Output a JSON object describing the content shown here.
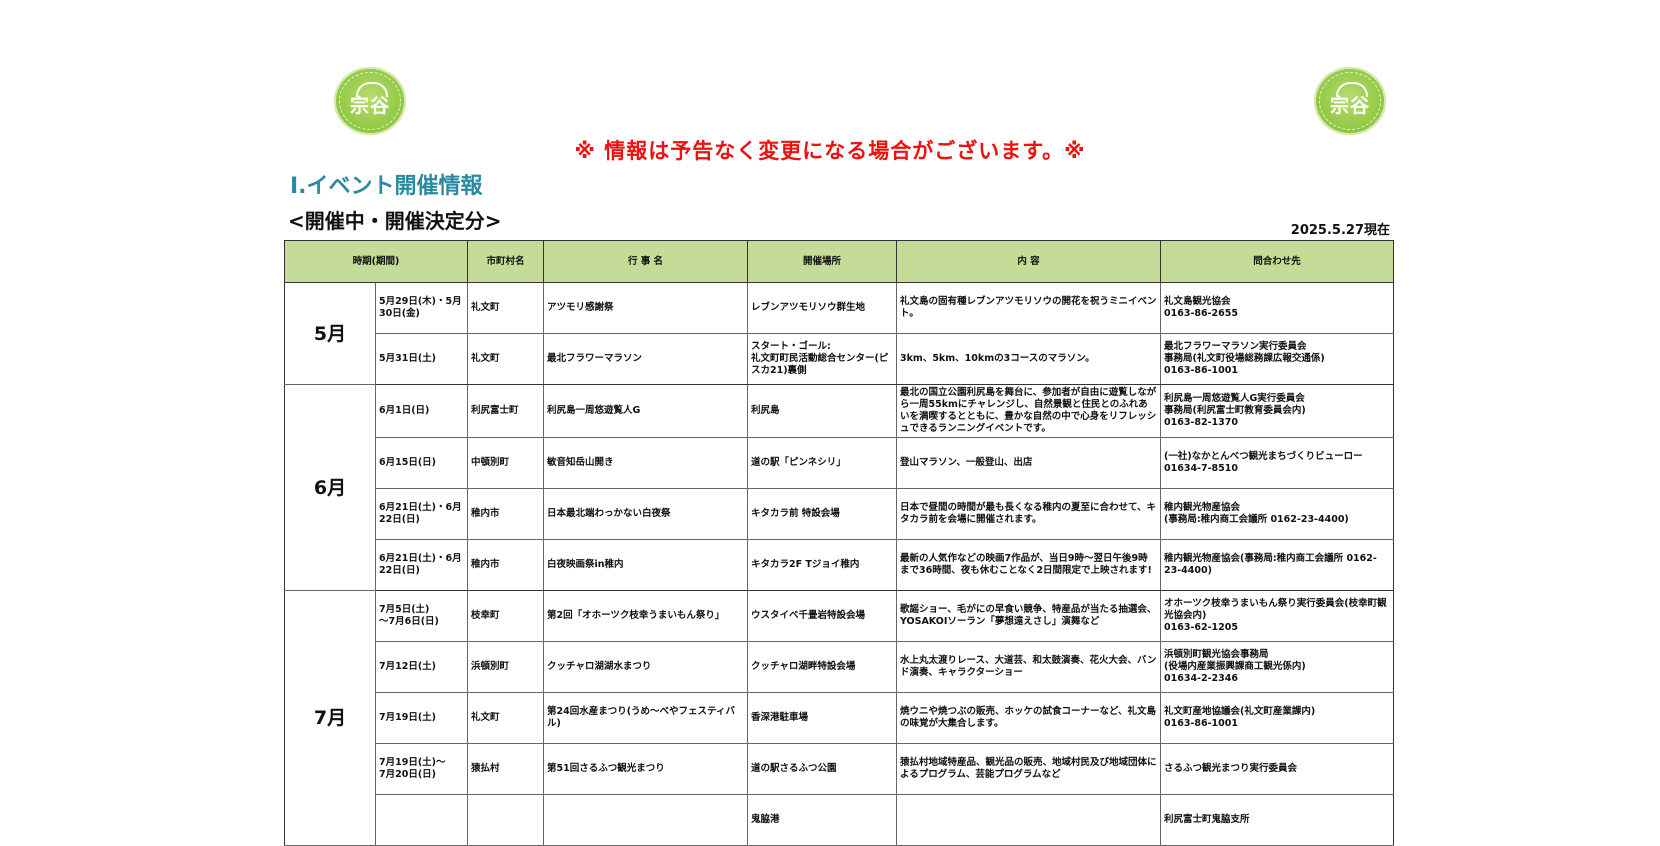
{
  "logo": {
    "text": "宗谷"
  },
  "notice": "※ 情報は予告なく変更になる場合がございます。※",
  "section_title": "Ⅰ.イベント開催情報",
  "sub_title": "<開催中・開催決定分>",
  "as_of": "2025.5.27現在",
  "colors": {
    "header_bg": "#c4dc98",
    "notice": "#ee1111",
    "section_title": "#2b8aa1",
    "logo": "#8cc63f"
  },
  "table": {
    "headers": [
      "時期(期間)",
      "市町村名",
      "行 事 名",
      "開催場所",
      "内 容",
      "問合わせ先"
    ],
    "groups": [
      {
        "month": "5月",
        "rows": [
          {
            "date": "5月29日(木)・5月30日(金)",
            "town": "礼文町",
            "event": "アツモリ感謝祭",
            "place": "レブンアツモリソウ群生地",
            "content": "礼文島の固有種レブンアツモリソウの開花を祝うミニイベント。",
            "contact": "礼文島観光協会\n0163-86-2655"
          },
          {
            "date": "5月31日(土)",
            "town": "礼文町",
            "event": "最北フラワーマラソン",
            "place": "スタート・ゴール:\n礼文町町民活動総合センター(ピスカ21)裏側",
            "content": "3km、5km、10kmの3コースのマラソン。",
            "contact": "最北フラワーマラソン実行委員会\n事務局(礼文町役場総務課広報交通係)\n0163-86-1001"
          }
        ]
      },
      {
        "month": "6月",
        "rows": [
          {
            "date": "6月1日(日)",
            "town": "利尻富士町",
            "event": "利尻島一周悠遊覧人G",
            "place": "利尻島",
            "content": "最北の国立公園利尻島を舞台に、参加者が自由に遊覧しながら一周55kmにチャレンジし、自然景観と住民とのふれあいを満喫するとともに、豊かな自然の中で心身をリフレッシュできるランニングイベントです。",
            "contact": "利尻島一周悠遊覧人G実行委員会\n事務局(利尻富士町教育委員会内)\n0163-82-1370"
          },
          {
            "date": "6月15日(日)",
            "town": "中頓別町",
            "event": "敏音知岳山開き",
            "place": "道の駅「ピンネシリ」",
            "content": "登山マラソン、一般登山、出店",
            "contact": "(一社)なかとんべつ観光まちづくりビューロー\n01634-7-8510"
          },
          {
            "date": "6月21日(土)・6月22日(日)",
            "town": "稚内市",
            "event": "日本最北端わっかない白夜祭",
            "place": "キタカラ前 特設会場",
            "content": "日本で昼間の時間が最も長くなる稚内の夏至に合わせて、キタカラ前を会場に開催されます。",
            "contact": "稚内観光物産協会\n(事務局:稚内商工会議所 0162-23-4400)"
          },
          {
            "date": "6月21日(土)・6月22日(日)",
            "town": "稚内市",
            "event": "白夜映画祭in稚内",
            "place": "キタカラ2F Tジョイ稚内",
            "content": "最新の人気作などの映画7作品が、当日9時～翌日午後9時まで36時間、夜も休むことなく2日間限定で上映されます!",
            "contact": "稚内観光物産協会(事務局:稚内商工会議所 0162-23-4400)"
          }
        ]
      },
      {
        "month": "7月",
        "rows": [
          {
            "date": "7月5日(土)\n～7月6日(日)",
            "town": "枝幸町",
            "event": "第2回「オホーツク枝幸うまいもん祭り」",
            "place": "ウスタイベ千畳岩特設会場",
            "content": "歌謡ショー、毛がにの早食い競争、特産品が当たる抽選会、YOSAKOIソーラン「夢想遠えさし」演舞など",
            "contact": "オホーツク枝幸うまいもん祭り実行委員会(枝幸町観光協会内)\n0163-62-1205"
          },
          {
            "date": "7月12日(土)",
            "town": "浜頓別町",
            "event": "クッチャロ湖湖水まつり",
            "place": "クッチャロ湖畔特設会場",
            "content": "水上丸太渡りレース、大道芸、和太鼓演奏、花火大会、バンド演奏、キャラクターショー",
            "contact": "浜頓別町観光協会事務局\n(役場内産業振興課商工観光係内)\n01634-2-2346"
          },
          {
            "date": "7月19日(土)",
            "town": "礼文町",
            "event": "第24回水産まつり(うめ～べやフェスティバル)",
            "place": "香深港駐車場",
            "content": "焼ウニや焼つぶの販売、ホッケの試食コーナーなど、礼文島の味覚が大集合します。",
            "contact": "礼文町産地協議会(礼文町産業課内)\n0163-86-1001"
          },
          {
            "date": "7月19日(土)～\n7月20日(日)",
            "town": "猿払村",
            "event": "第51回さるふつ観光まつり",
            "place": "道の駅さるふつ公園",
            "content": "猿払村地域特産品、観光品の販売、地域村民及び地域団体によるプログラム、芸能プログラムなど",
            "contact": "さるふつ観光まつり実行委員会"
          },
          {
            "date": "",
            "town": "",
            "event": "",
            "place": "鬼脇港",
            "content": "",
            "contact": "利尻富士町鬼脇支所"
          }
        ]
      }
    ]
  }
}
